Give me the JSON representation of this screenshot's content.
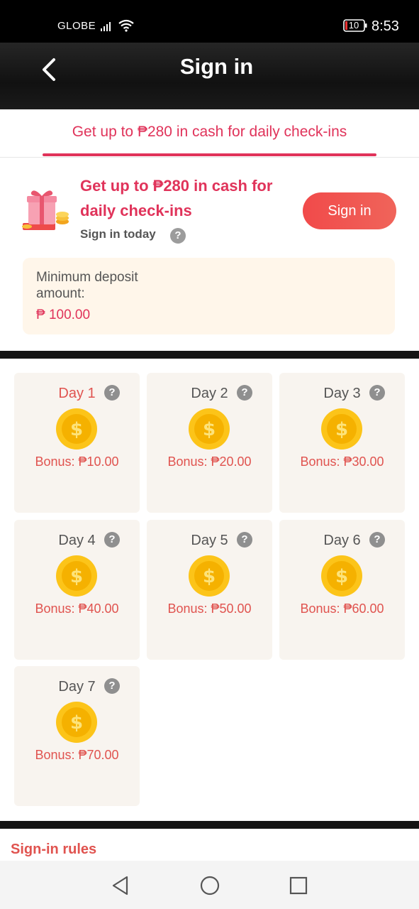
{
  "status_bar": {
    "carrier": "GLOBE",
    "battery": "10",
    "time": "8:53"
  },
  "header": {
    "title": "Sign in",
    "back_icon": "chevron-left-icon"
  },
  "tab": {
    "label": "Get up to ₱280 in cash for daily check-ins"
  },
  "signin_card": {
    "headline": "Get up to ₱280 in cash for daily check-ins",
    "subtext": "Sign in today",
    "help_glyph": "?",
    "button_label": "Sign in",
    "icon": "gift-box-icon"
  },
  "deposit": {
    "label": "Minimum deposit amount:",
    "value": "₱ 100.00"
  },
  "days": [
    {
      "label": "Day 1",
      "bonus": "Bonus: ₱10.00",
      "active": true
    },
    {
      "label": "Day 2",
      "bonus": "Bonus: ₱20.00",
      "active": false
    },
    {
      "label": "Day 3",
      "bonus": "Bonus: ₱30.00",
      "active": false
    },
    {
      "label": "Day 4",
      "bonus": "Bonus: ₱40.00",
      "active": false
    },
    {
      "label": "Day 5",
      "bonus": "Bonus: ₱50.00",
      "active": false
    },
    {
      "label": "Day 6",
      "bonus": "Bonus: ₱60.00",
      "active": false
    },
    {
      "label": "Day 7",
      "bonus": "Bonus: ₱70.00",
      "active": false
    }
  ],
  "rules": {
    "title": "Sign-in rules"
  },
  "colors": {
    "accent": "#e0335a",
    "button": "#f14a4a",
    "card_bg": "#f8f4ef",
    "deposit_bg": "#fff6ea"
  }
}
